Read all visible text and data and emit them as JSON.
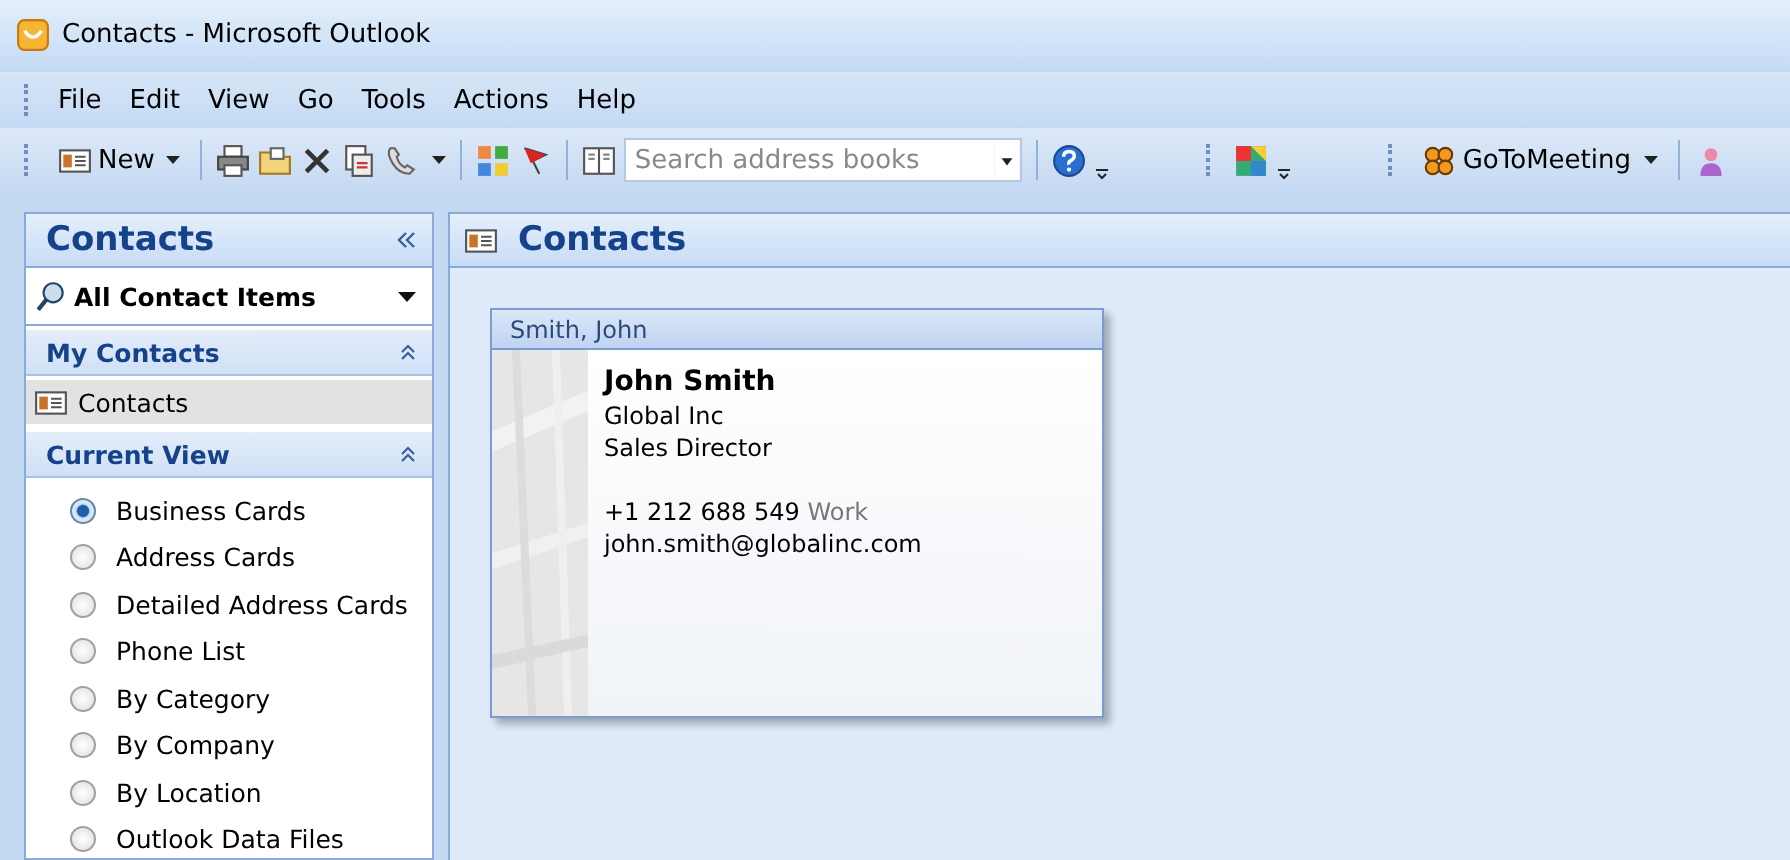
{
  "window": {
    "title": "Contacts - Microsoft Outlook"
  },
  "menu": [
    "File",
    "Edit",
    "View",
    "Go",
    "Tools",
    "Actions",
    "Help"
  ],
  "toolbar": {
    "new_label": "New",
    "search": {
      "placeholder": "Search address books"
    },
    "addin_label": "GoToMeeting"
  },
  "sidebar": {
    "title": "Contacts",
    "filter": "All Contact Items",
    "sections": [
      {
        "title": "My Contacts",
        "expanded": true,
        "items": [
          {
            "label": "Contacts",
            "selected": true
          }
        ]
      }
    ],
    "view_title": "Current View",
    "view_expanded": true,
    "views": [
      {
        "label": "Business Cards",
        "selected": true
      },
      {
        "label": "Address Cards",
        "selected": false
      },
      {
        "label": "Detailed Address Cards",
        "selected": false
      },
      {
        "label": "Phone List",
        "selected": false
      },
      {
        "label": "By Category",
        "selected": false
      },
      {
        "label": "By Company",
        "selected": false
      },
      {
        "label": "By Location",
        "selected": false
      },
      {
        "label": "Outlook Data Files",
        "selected": false
      }
    ]
  },
  "content": {
    "title": "Contacts",
    "cards": [
      {
        "file_as": "Smith, John",
        "name": "John Smith",
        "company": "Global Inc",
        "job_title": "Sales Director",
        "phone": "+1 212 688 549",
        "phone_type": "Work",
        "email": "john.smith@globalinc.com"
      }
    ]
  }
}
